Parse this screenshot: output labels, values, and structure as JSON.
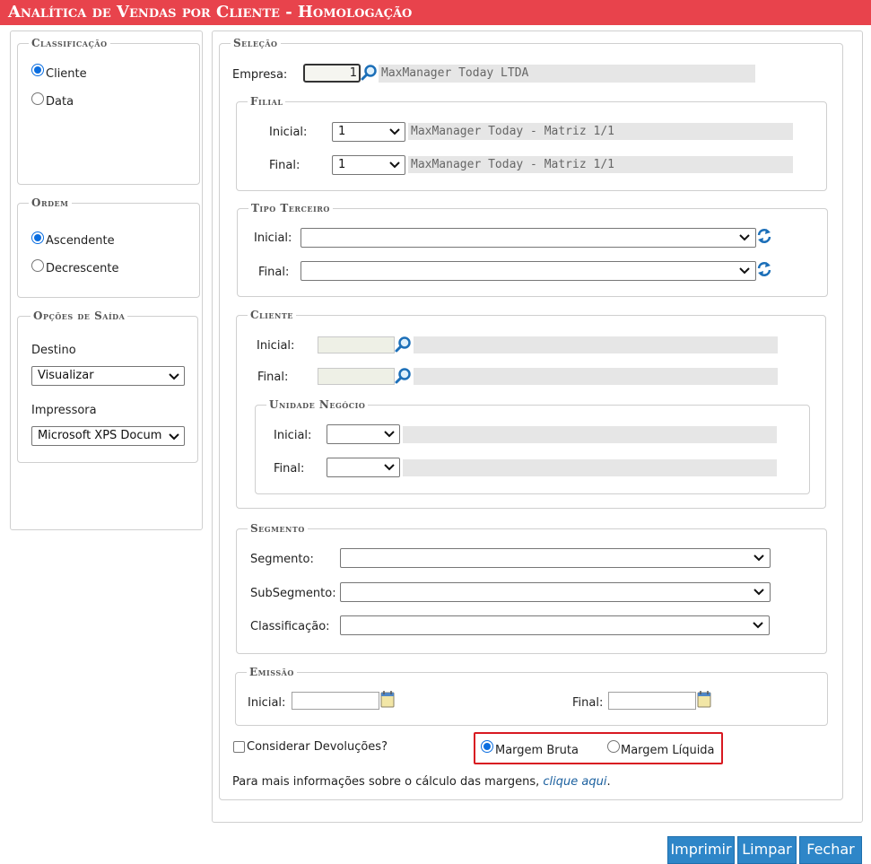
{
  "window": {
    "title": "Analítica de Vendas por Cliente  - Homologação"
  },
  "classificacao": {
    "legend": "Classificação",
    "options": [
      {
        "label": "Cliente",
        "selected": true
      },
      {
        "label": "Data",
        "selected": false
      }
    ]
  },
  "ordem": {
    "legend": "Ordem",
    "options": [
      {
        "label": "Ascendente",
        "selected": true
      },
      {
        "label": "Decrescente",
        "selected": false
      }
    ]
  },
  "saida": {
    "legend": "Opções de Saída",
    "destino_label": "Destino",
    "destino_value": "Visualizar",
    "impressora_label": "Impressora",
    "impressora_value": "Microsoft XPS Docum"
  },
  "selecao": {
    "legend": "Seleção",
    "empresa_label": "Empresa:",
    "empresa_code": "1",
    "empresa_name": "MaxManager Today LTDA"
  },
  "filial": {
    "legend": "Filial",
    "inicial_label": "Inicial:",
    "inicial_value": "1",
    "inicial_name": "MaxManager Today - Matriz 1/1",
    "final_label": "Final:",
    "final_value": "1",
    "final_name": "MaxManager Today - Matriz 1/1"
  },
  "tipo_terceiro": {
    "legend": "Tipo Terceiro",
    "inicial_label": "Inicial:",
    "final_label": "Final:"
  },
  "cliente": {
    "legend": "Cliente",
    "inicial_label": "Inicial:",
    "final_label": "Final:"
  },
  "unidade_negocio": {
    "legend": "Unidade Negócio",
    "inicial_label": "Inicial:",
    "final_label": "Final:"
  },
  "segmento": {
    "legend": "Segmento",
    "segmento_label": "Segmento:",
    "subsegmento_label": "SubSegmento:",
    "classificacao_label": "Classificação:"
  },
  "emissao": {
    "legend": "Emissão",
    "inicial_label": "Inicial:",
    "final_label": "Final:"
  },
  "options": {
    "devolucoes_label": "Considerar Devoluções?",
    "devolucoes_checked": false,
    "margem_bruta_label": "Margem Bruta",
    "margem_bruta_selected": true,
    "margem_liquida_label": "Margem Líquida",
    "margem_liquida_selected": false
  },
  "info": {
    "text": "Para mais informações sobre o cálculo das margens, ",
    "link": "clique aqui",
    "suffix": "."
  },
  "buttons": {
    "imprimir": "Imprimir",
    "limpar": "Limpar",
    "fechar": "Fechar"
  },
  "colors": {
    "titlebar": "#e8434c",
    "accent": "#0b6ee0",
    "button": "#2e86c8",
    "highlight": "#d81921"
  },
  "icons": [
    "search-icon",
    "refresh-icon",
    "calendar-icon",
    "chevron-down-icon"
  ]
}
